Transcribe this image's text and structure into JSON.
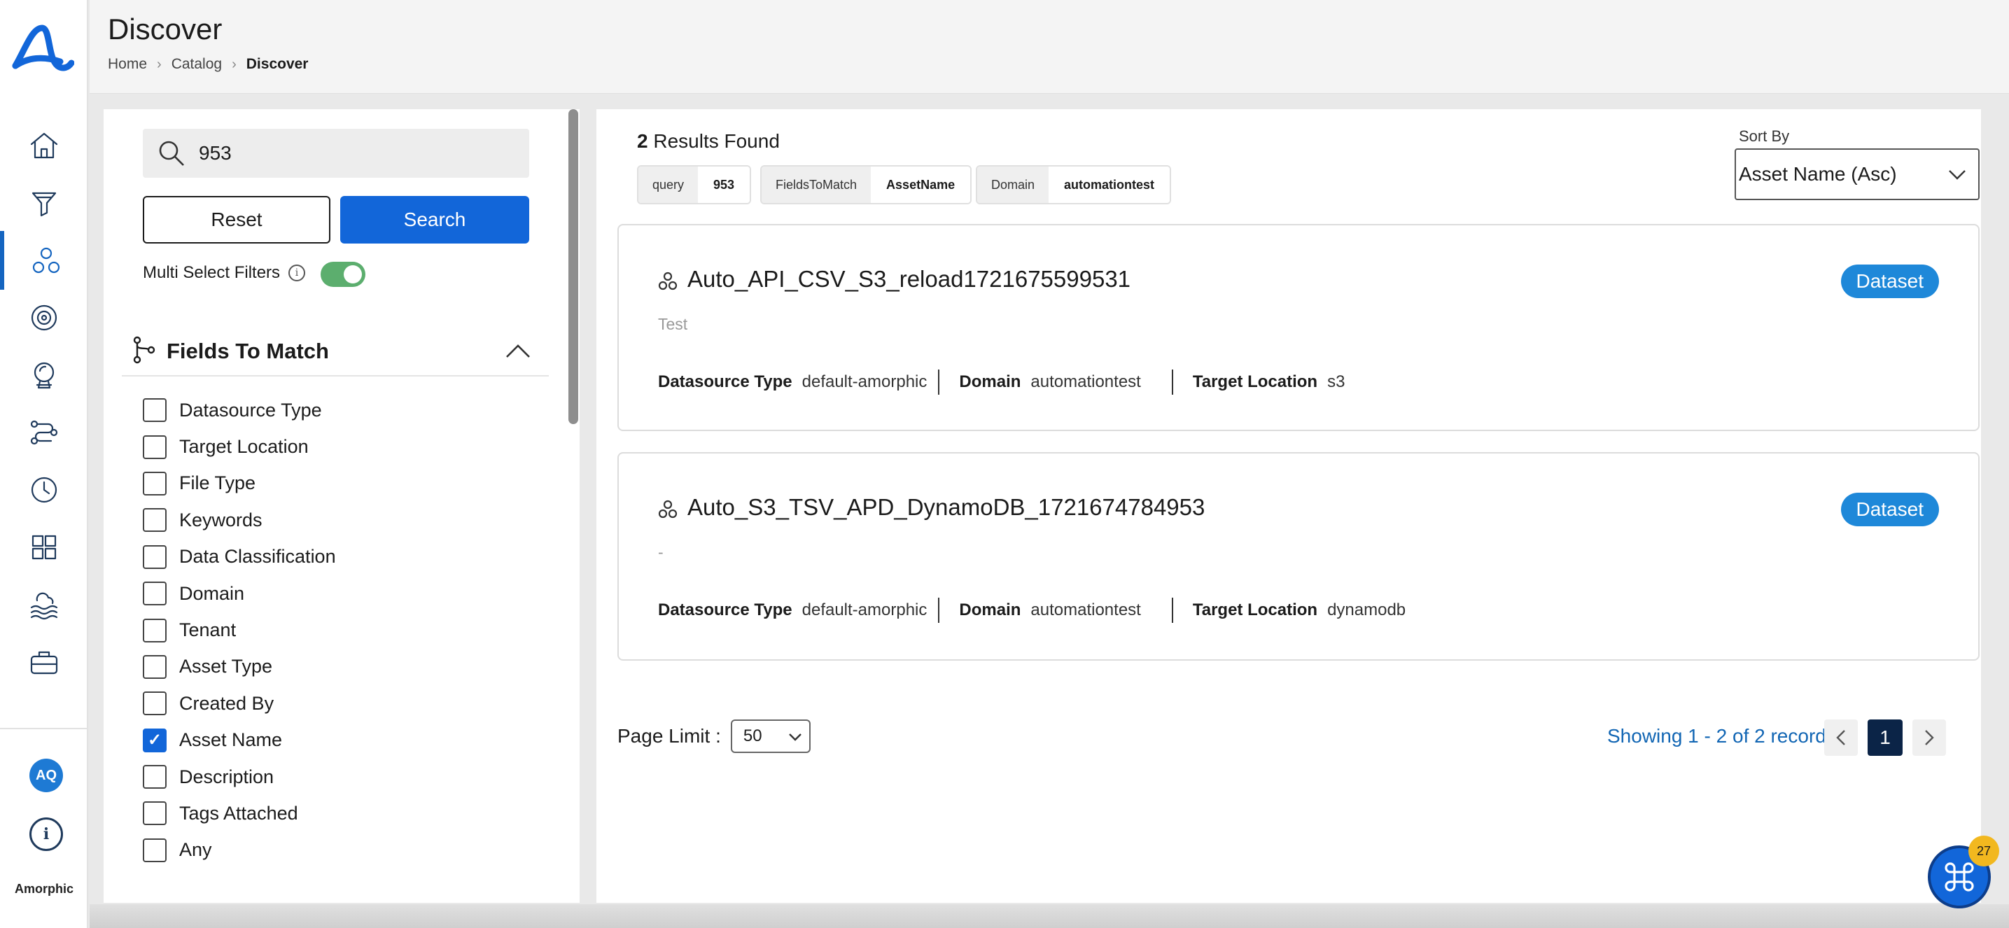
{
  "app": {
    "brand": "Amorphic",
    "avatar_initials": "AQ"
  },
  "header": {
    "title": "Discover",
    "breadcrumbs": [
      "Home",
      "Catalog",
      "Discover"
    ]
  },
  "nav_icons": [
    "home-icon",
    "filter-funnel-icon",
    "datasets-icon",
    "settings-gear-icon",
    "explorer-icon",
    "pipelines-icon",
    "schedule-clock-icon",
    "integrations-puzzle-icon",
    "datalake-waves-icon",
    "toolbox-icon"
  ],
  "filters": {
    "search_value": "953",
    "reset_label": "Reset",
    "search_label": "Search",
    "multi_select_label": "Multi Select Filters",
    "multi_select_enabled": true,
    "section_title": "Fields To Match",
    "fields": [
      {
        "label": "Datasource Type",
        "checked": false
      },
      {
        "label": "Target Location",
        "checked": false
      },
      {
        "label": "File Type",
        "checked": false
      },
      {
        "label": "Keywords",
        "checked": false
      },
      {
        "label": "Data Classification",
        "checked": false
      },
      {
        "label": "Domain",
        "checked": false
      },
      {
        "label": "Tenant",
        "checked": false
      },
      {
        "label": "Asset Type",
        "checked": false
      },
      {
        "label": "Created By",
        "checked": false
      },
      {
        "label": "Asset Name",
        "checked": true
      },
      {
        "label": "Description",
        "checked": false
      },
      {
        "label": "Tags Attached",
        "checked": false
      },
      {
        "label": "Any",
        "checked": false
      }
    ]
  },
  "results": {
    "count": "2",
    "count_suffix": "Results Found",
    "chips": [
      {
        "key": "query",
        "value": "953"
      },
      {
        "key": "FieldsToMatch",
        "value": "AssetName"
      },
      {
        "key": "Domain",
        "value": "automationtest"
      }
    ],
    "sort_label": "Sort By",
    "sort_value": "Asset Name (Asc)",
    "items": [
      {
        "name": "Auto_API_CSV_S3_reload1721675599531",
        "description": "Test",
        "badge": "Dataset",
        "meta": [
          {
            "key": "Datasource Type",
            "value": "default-amorphic"
          },
          {
            "key": "Domain",
            "value": "automationtest"
          },
          {
            "key": "Target Location",
            "value": "s3"
          }
        ]
      },
      {
        "name": "Auto_S3_TSV_APD_DynamoDB_1721674784953",
        "description": "-",
        "badge": "Dataset",
        "meta": [
          {
            "key": "Datasource Type",
            "value": "default-amorphic"
          },
          {
            "key": "Domain",
            "value": "automationtest"
          },
          {
            "key": "Target Location",
            "value": "dynamodb"
          }
        ]
      }
    ],
    "page_limit_label": "Page Limit :",
    "page_limit_value": "50",
    "showing_text": "Showing 1 - 2 of 2 record(s)",
    "current_page": "1"
  },
  "floating": {
    "notification_count": "27"
  },
  "colors": {
    "primary": "#1266d9",
    "badge": "#1e88d9",
    "toggle_on": "#5cae6e",
    "page_active": "#0b2447"
  }
}
